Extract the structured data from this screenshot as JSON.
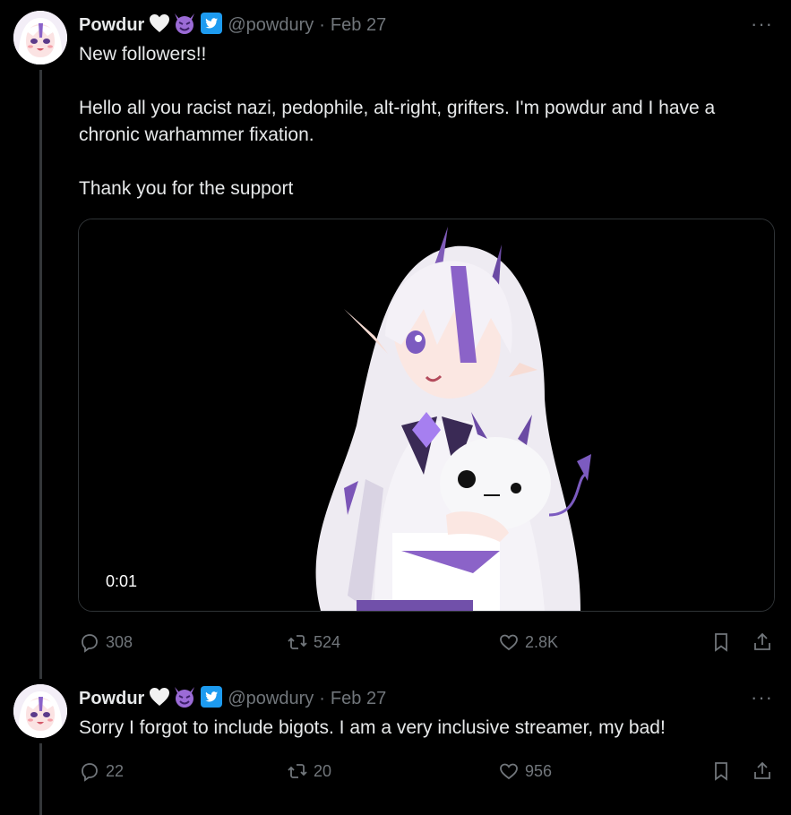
{
  "tweets": [
    {
      "name": "Powdur",
      "emojis": [
        "white-heart",
        "purple-devil",
        "twitter-bird"
      ],
      "handle": "@powdury",
      "separator": "·",
      "date": "Feb 27",
      "more": "···",
      "paragraphs": [
        "New followers!!",
        "Hello all you racist nazi, pedophile, alt-right, grifters. I'm powdur and I have a chronic warhammer fixation.",
        "Thank you for the support"
      ],
      "media": {
        "type": "video",
        "timestamp": "0:01"
      },
      "stats": {
        "replies": "308",
        "retweets": "524",
        "likes": "2.8K"
      }
    },
    {
      "name": "Powdur",
      "emojis": [
        "white-heart",
        "purple-devil",
        "twitter-bird"
      ],
      "handle": "@powdury",
      "separator": "·",
      "date": "Feb 27",
      "more": "···",
      "paragraphs": [
        "Sorry I forgot to include bigots. I am a very inclusive streamer, my bad!"
      ],
      "stats": {
        "replies": "22",
        "retweets": "20",
        "likes": "956"
      }
    }
  ],
  "colors": {
    "background": "#000000",
    "text": "#e7e9ea",
    "muted": "#71767b",
    "border": "#2f3336",
    "accent": "#1d9bf0",
    "devil": "#9b6bd6"
  }
}
